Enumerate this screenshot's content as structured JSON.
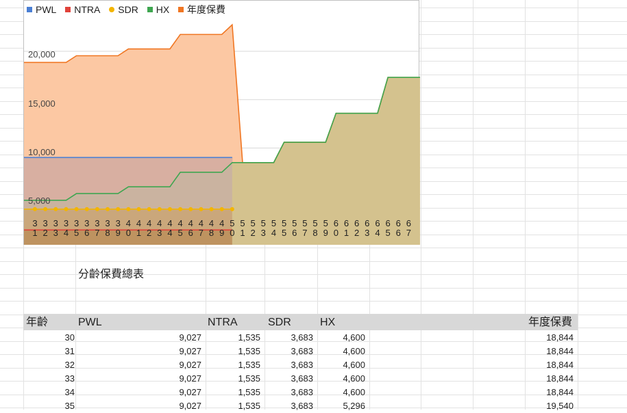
{
  "legend": [
    {
      "label": "PWL",
      "color": "#4a7fd4",
      "marker": "square"
    },
    {
      "label": "NTRA",
      "color": "#e0423a",
      "marker": "square"
    },
    {
      "label": "SDR",
      "color": "#f3b500",
      "marker": "dot"
    },
    {
      "label": "HX",
      "color": "#3ea650",
      "marker": "square"
    },
    {
      "label": "年度保費",
      "color": "#f07622",
      "marker": "square"
    }
  ],
  "chart_data": {
    "type": "area",
    "y_ticks": [
      "5,000",
      "10,000",
      "15,000",
      "20,000"
    ],
    "ylim": [
      0,
      25000
    ],
    "x": [
      31,
      32,
      33,
      34,
      35,
      36,
      37,
      38,
      39,
      40,
      41,
      42,
      43,
      44,
      45,
      46,
      47,
      48,
      49,
      50,
      51,
      52,
      53,
      54,
      55,
      56,
      57,
      58,
      59,
      60,
      61,
      62,
      63,
      64,
      65,
      66,
      67
    ],
    "series": [
      {
        "name": "PWL",
        "color": "#4a7fd4",
        "values": [
          9027,
          9027,
          9027,
          9027,
          9027,
          9027,
          9027,
          9027,
          9027,
          9027,
          9027,
          9027,
          9027,
          9027,
          9027,
          9027,
          9027,
          9027,
          9027,
          9027,
          null,
          null,
          null,
          null,
          null,
          null,
          null,
          null,
          null,
          null,
          null,
          null,
          null,
          null,
          null,
          null,
          null
        ]
      },
      {
        "name": "NTRA",
        "color": "#e0423a",
        "values": [
          1535,
          1535,
          1535,
          1535,
          1535,
          1535,
          1535,
          1535,
          1535,
          1535,
          1535,
          1535,
          1535,
          1535,
          1535,
          1535,
          1535,
          1535,
          1535,
          1535,
          null,
          null,
          null,
          null,
          null,
          null,
          null,
          null,
          null,
          null,
          null,
          null,
          null,
          null,
          null,
          null,
          null
        ]
      },
      {
        "name": "SDR",
        "color": "#f3b500",
        "values": [
          3683,
          3683,
          3683,
          3683,
          3683,
          3683,
          3683,
          3683,
          3683,
          3683,
          3683,
          3683,
          3683,
          3683,
          3683,
          3683,
          3683,
          3683,
          3683,
          3683,
          null,
          null,
          null,
          null,
          null,
          null,
          null,
          null,
          null,
          null,
          null,
          null,
          null,
          null,
          null,
          null,
          null
        ]
      },
      {
        "name": "HX",
        "color": "#3ea650",
        "values": [
          4600,
          4600,
          4600,
          4600,
          5296,
          5296,
          5296,
          5296,
          5296,
          5996,
          5996,
          5996,
          5996,
          5996,
          7497,
          7497,
          7497,
          7497,
          7497,
          8496,
          8496,
          8496,
          8496,
          8496,
          10596,
          10596,
          10596,
          10596,
          10596,
          13594,
          13594,
          13594,
          13594,
          13594,
          17304,
          17304,
          17304
        ]
      },
      {
        "name": "年度保費",
        "color": "#f07622",
        "values": [
          18844,
          18844,
          18844,
          18844,
          19540,
          19540,
          19540,
          19540,
          19540,
          20240,
          20240,
          20240,
          20240,
          20240,
          21741,
          21741,
          21741,
          21741,
          21741,
          22740,
          8496,
          8496,
          8496,
          8496,
          10596,
          10596,
          10596,
          10596,
          10596,
          13594,
          13594,
          13594,
          13594,
          13594,
          17304,
          17304,
          17304
        ]
      }
    ]
  },
  "sheet": {
    "title": "分齡保費總表",
    "headers": {
      "age": "年齡",
      "pwl": "PWL",
      "ntra": "NTRA",
      "sdr": "SDR",
      "hx": "HX",
      "total": "年度保費"
    },
    "rows": [
      {
        "age": "30",
        "pwl": "9,027",
        "ntra": "1,535",
        "sdr": "3,683",
        "hx": "4,600",
        "total": "18,844"
      },
      {
        "age": "31",
        "pwl": "9,027",
        "ntra": "1,535",
        "sdr": "3,683",
        "hx": "4,600",
        "total": "18,844"
      },
      {
        "age": "32",
        "pwl": "9,027",
        "ntra": "1,535",
        "sdr": "3,683",
        "hx": "4,600",
        "total": "18,844"
      },
      {
        "age": "33",
        "pwl": "9,027",
        "ntra": "1,535",
        "sdr": "3,683",
        "hx": "4,600",
        "total": "18,844"
      },
      {
        "age": "34",
        "pwl": "9,027",
        "ntra": "1,535",
        "sdr": "3,683",
        "hx": "4,600",
        "total": "18,844"
      },
      {
        "age": "35",
        "pwl": "9,027",
        "ntra": "1,535",
        "sdr": "3,683",
        "hx": "5,296",
        "total": "19,540"
      }
    ]
  }
}
